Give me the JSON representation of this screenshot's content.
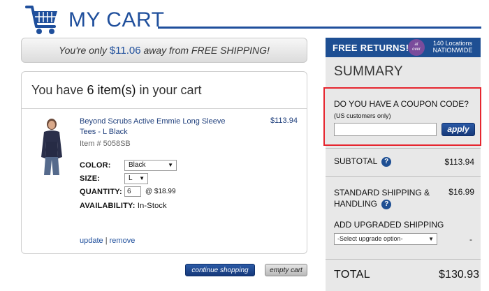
{
  "header": {
    "title": "MY CART",
    "cart_icon": "shopping-cart-icon"
  },
  "shipping_banner": {
    "prefix": "You're only",
    "amount": "$11.06",
    "suffix": "away from FREE SHIPPING!"
  },
  "cart": {
    "count_prefix": "You have",
    "count": "6 item(s)",
    "count_suffix": "in your cart",
    "item": {
      "name": "Beyond Scrubs Active Emmie Long Sleeve Tees - L Black",
      "sku": "Item # 5058SB",
      "price": "$113.94",
      "color_label": "COLOR:",
      "color_value": "Black",
      "size_label": "SIZE:",
      "size_value": "L",
      "quantity_label": "QUANTITY:",
      "quantity_value": "6",
      "unit_price": "@ $18.99",
      "availability_label": "AVAILABILITY:",
      "availability_value": "In-Stock",
      "update_link": "update",
      "remove_link": "remove"
    }
  },
  "buttons": {
    "continue": "continue shopping",
    "empty": "empty cart"
  },
  "returns_banner": {
    "text": "FREE RETURNS!",
    "badge_line1": "at",
    "badge_line2": "over",
    "locations_line1": "140 Locations",
    "locations_line2": "NATIONWIDE"
  },
  "summary": {
    "title": "SUMMARY",
    "coupon_question": "DO YOU HAVE A COUPON CODE?",
    "coupon_note": "(US customers only)",
    "coupon_placeholder": "",
    "apply_label": "apply",
    "subtotal_label": "SUBTOTAL",
    "subtotal_value": "$113.94",
    "shipping_label": "STANDARD SHIPPING & HANDLING",
    "shipping_value": "$16.99",
    "upgrade_label": "ADD UPGRADED SHIPPING",
    "upgrade_option": "-Select upgrade option-",
    "upgrade_value": "-",
    "total_label": "TOTAL",
    "total_value": "$130.93",
    "help_glyph": "?"
  },
  "colors": {
    "brand_blue": "#1f4f9c",
    "highlight_red": "#e6262f",
    "panel_gray": "#e8e8e8"
  }
}
